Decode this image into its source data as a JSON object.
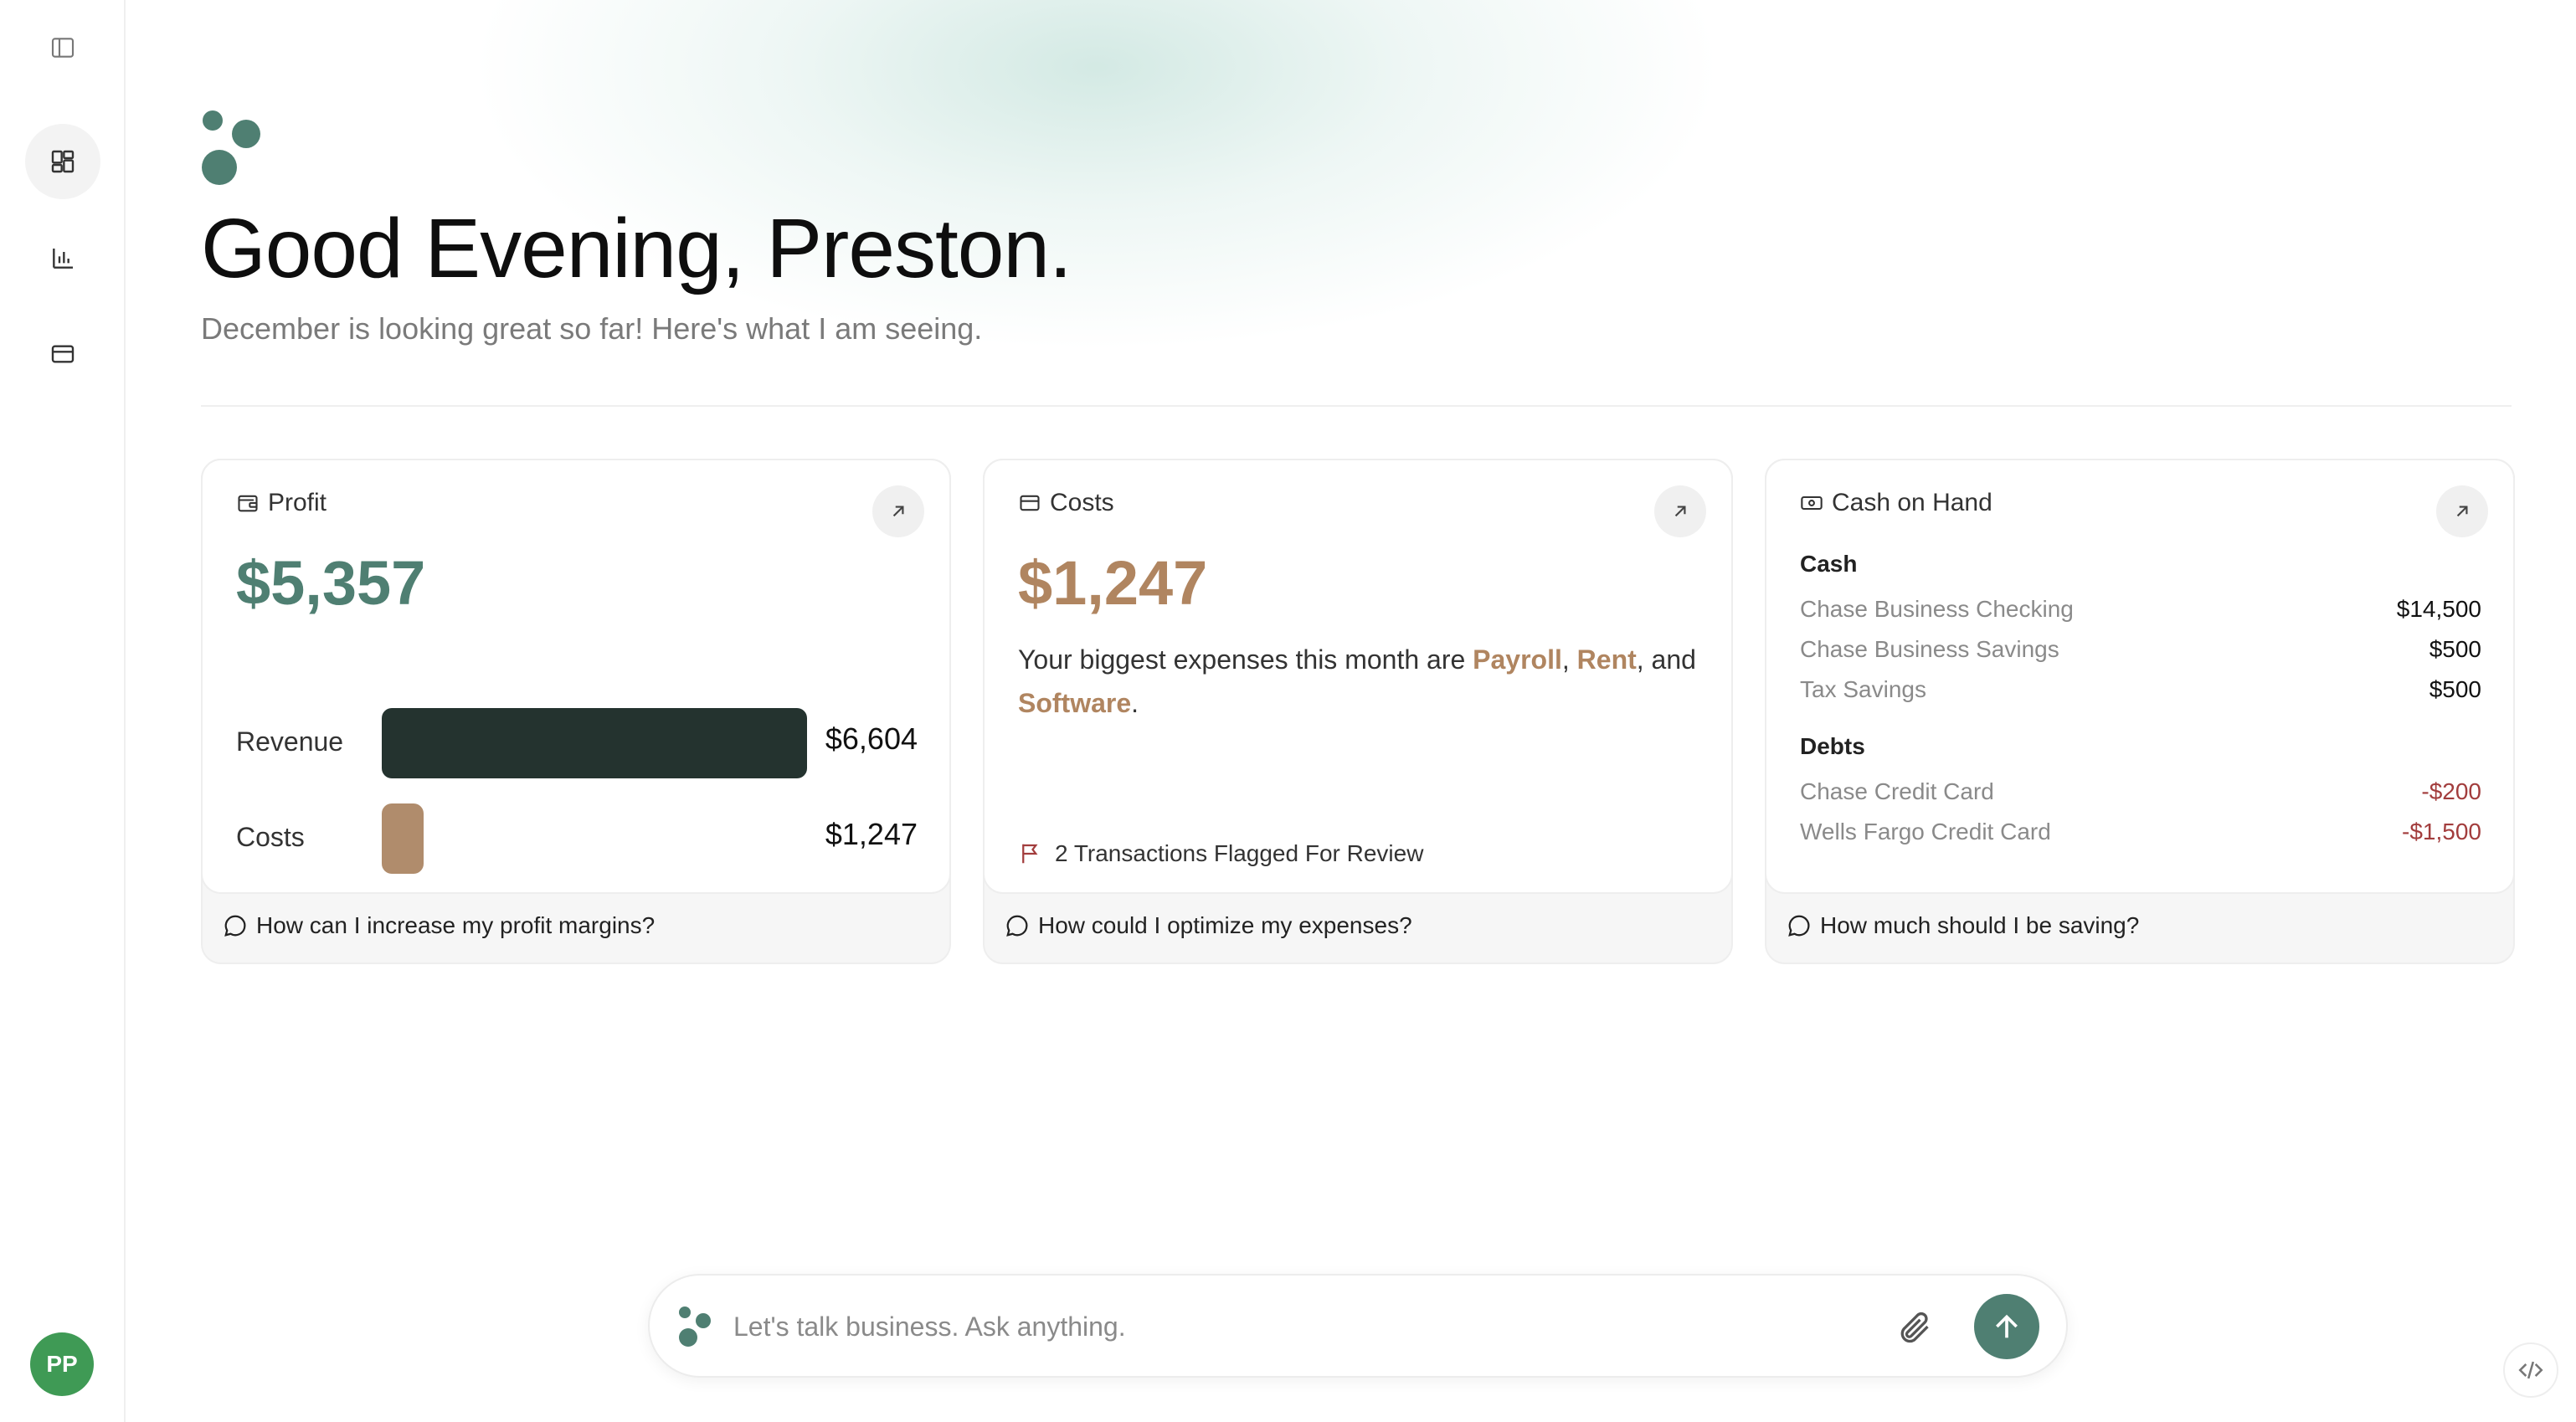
{
  "greeting": {
    "title": "Good Evening, Preston.",
    "subtitle": "December is looking great so far! Here's what I am seeing."
  },
  "user": {
    "initials": "PP"
  },
  "colors": {
    "accent": "#4f7f72",
    "cost": "#b08560",
    "revenue_bar": "#24332f",
    "cost_bar": "#b08c6c",
    "negative": "#a23d3d",
    "avatar": "#3f9a55"
  },
  "sidebar": {
    "icons": [
      "sidebar-toggle-icon",
      "dashboard-icon",
      "bar-chart-icon",
      "credit-card-icon"
    ]
  },
  "cards": {
    "profit": {
      "title": "Profit",
      "value": "$5,357",
      "revenue": {
        "label": "Revenue",
        "value": "$6,604",
        "amount": 6604
      },
      "costs": {
        "label": "Costs",
        "value": "$1,247",
        "amount": 1247
      },
      "suggestion": "How can I increase my profit margins?"
    },
    "costs": {
      "title": "Costs",
      "value": "$1,247",
      "text_before": "Your biggest expenses this month are ",
      "highlights": [
        "Payroll",
        "Rent",
        "Software"
      ],
      "sep1": ", ",
      "sep2": ", and ",
      "end": ".",
      "flag_text": "2 Transactions Flagged For Review",
      "suggestion": "How could I optimize my expenses?"
    },
    "cash": {
      "title": "Cash on Hand",
      "cash_heading": "Cash",
      "cash_accounts": [
        {
          "name": "Chase Business Checking",
          "value": "$14,500"
        },
        {
          "name": "Chase Business Savings",
          "value": "$500"
        },
        {
          "name": "Tax Savings",
          "value": "$500"
        }
      ],
      "debts_heading": "Debts",
      "debts": [
        {
          "name": "Chase Credit Card",
          "value": "-$200"
        },
        {
          "name": "Wells Fargo Credit Card",
          "value": "-$1,500"
        }
      ],
      "suggestion": "How much should I be saving?"
    }
  },
  "chat": {
    "placeholder": "Let's talk business. Ask anything."
  }
}
